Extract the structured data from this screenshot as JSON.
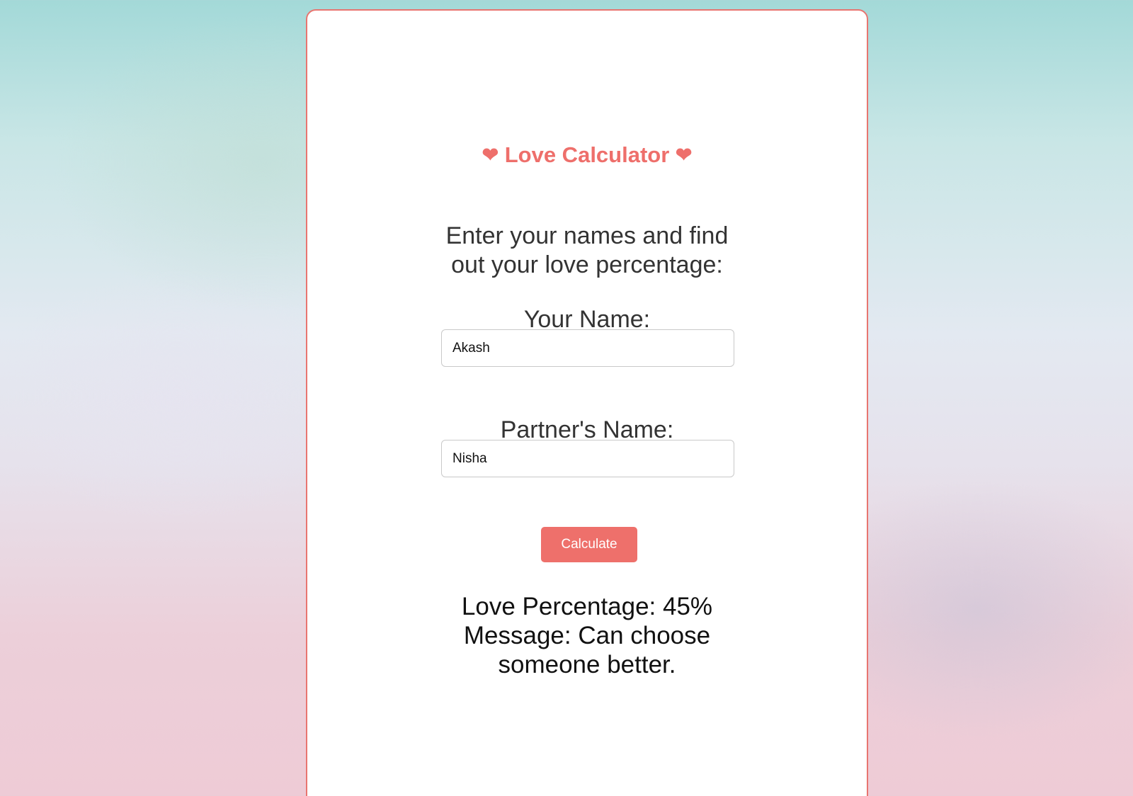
{
  "app": {
    "title_text": "Love Calculator",
    "title_heart_left": "❤",
    "title_heart_right": "❤",
    "intro_text": "Enter your names and find out your love percentage:"
  },
  "form": {
    "your_name_label": "Your Name:",
    "your_name_value": "Akash",
    "partner_name_label": "Partner's Name:",
    "partner_name_value": "Nisha",
    "calculate_label": "Calculate"
  },
  "result": {
    "percentage_line": "Love Percentage: 45%",
    "message_line": "Message: Can choose someone better."
  },
  "colors": {
    "accent": "#ee706b",
    "card_border": "#e87570",
    "text_dark": "#333333"
  },
  "icons": {
    "title_left": "heart-icon",
    "title_right": "heart-icon"
  }
}
